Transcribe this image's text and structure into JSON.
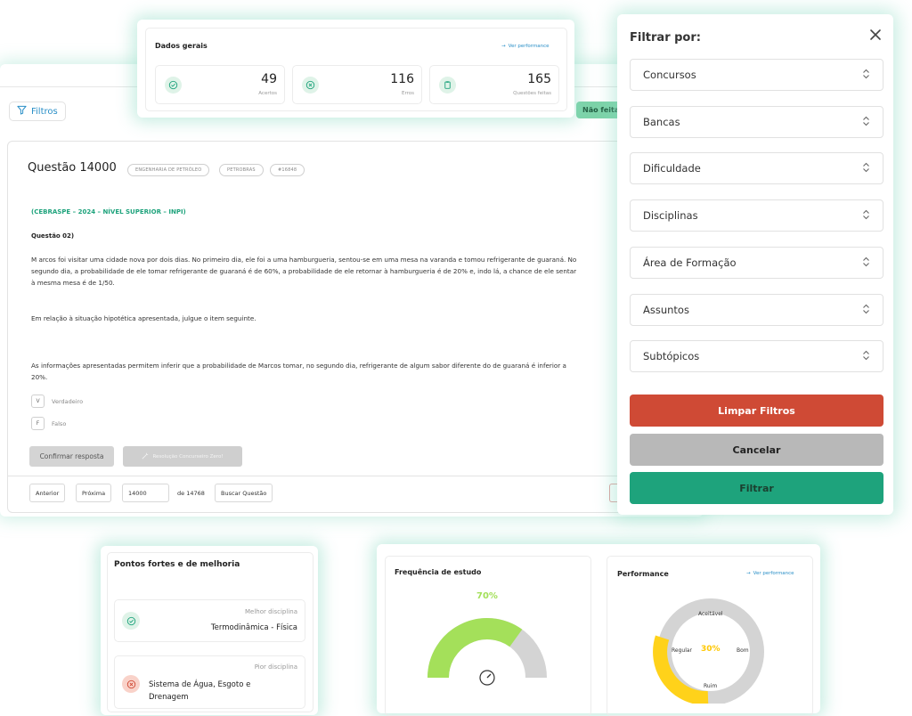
{
  "main": {
    "filtros_label": "Filtros",
    "nao_feitas_label": "Não feitas",
    "question": {
      "title": "Questão 14000",
      "tags": [
        "ENGENHARIA DE PETRÓLEO",
        "PETROBRAS",
        "#16848"
      ],
      "source": "(CEBRASPE – 2024 – NÍVEL SUPERIOR – INPI)",
      "number": "Questão 02)",
      "paragraph_lines": [
        "M arcos foi visitar uma cidade nova por dois dias. No primeiro dia, ele foi a uma hamburgueria, sentou-se em uma mesa na varanda e tomou refrigerante de guaraná. No",
        "segundo dia, a probabilidade de ele tomar refrigerante de guaraná é de 60%, a probabilidade de ele retornar à hamburgueria é de 20% e, indo lá, a chance de ele sentar",
        "à mesma mesa é de 1/50."
      ],
      "prompt": "Em relação à situação hipotética apresentada, julgue o item seguinte.",
      "statement_lines": [
        "As informações apresentadas permitem inferir que a probabilidade de Marcos tomar, no segundo dia, refrigerante de algum sabor diferente do de guaraná é inferior a",
        "20%."
      ],
      "options": [
        {
          "key": "V",
          "label": "Verdadeiro"
        },
        {
          "key": "F",
          "label": "Falso"
        }
      ],
      "confirm_label": "Confirmar resposta",
      "resolucao_label": "Resolução Concurseiro Zero!"
    },
    "pagination": {
      "prev_label": "Anterior",
      "next_label": "Próxima",
      "current_page": "14000",
      "total_label": "de 14768",
      "search_label": "Buscar Questão"
    }
  },
  "dados_gerais": {
    "title": "Dados gerais",
    "ver_performance": "Ver performance",
    "stats": [
      {
        "icon": "check-circle-icon",
        "value": "49",
        "label": "Acertos"
      },
      {
        "icon": "x-circle-icon",
        "value": "116",
        "label": "Erros"
      },
      {
        "icon": "clipboard-icon",
        "value": "165",
        "label": "Questões feitas"
      }
    ]
  },
  "filters": {
    "title": "Filtrar por:",
    "selects": [
      "Concursos",
      "Bancas",
      "Dificuldade",
      "Disciplinas",
      "Área de Formação",
      "Assuntos",
      "Subtópicos"
    ],
    "limpar_label": "Limpar Filtros",
    "cancelar_label": "Cancelar",
    "filtrar_label": "Filtrar"
  },
  "pontos": {
    "title": "Pontos fortes e de melhoria",
    "melhor_label": "Melhor disciplina",
    "melhor_value": "Termodinâmica - Física",
    "pior_label": "Pior disciplina",
    "pior_value_line1": "Sistema de Água, Esgoto e",
    "pior_value_line2": "Drenagem"
  },
  "frequencia": {
    "title": "Frequência de estudo",
    "percent_label": "70%",
    "percent_value": 0.7
  },
  "performance": {
    "title": "Performance",
    "ver_performance": "Ver performance",
    "center_label": "30%",
    "labels": {
      "top": "Aceitável",
      "left": "Regular",
      "right": "Bom",
      "bottom": "Ruim"
    }
  },
  "colors": {
    "accent": "#1ea37c",
    "link": "#2a8fc7",
    "danger": "#cf4a35",
    "gauge": "#a4e05a",
    "donut_yellow": "#ffd21a"
  }
}
